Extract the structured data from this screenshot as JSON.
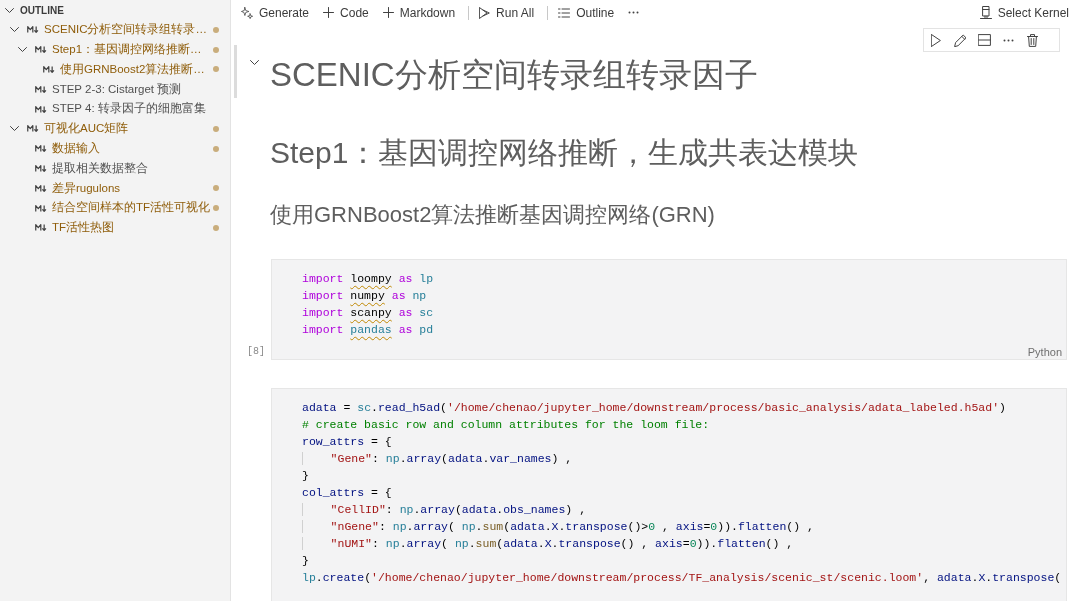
{
  "outline": {
    "title": "OUTLINE",
    "expanded": true,
    "items": [
      {
        "text": "SCENIC分析空间转录组转录…",
        "modified": true,
        "expanded": true,
        "children": [
          {
            "text": "Step1：基因调控网络推断…",
            "modified": true,
            "expanded": true,
            "children": [
              {
                "text": "使用GRNBoost2算法推断…",
                "modified": true
              }
            ]
          },
          {
            "text": "STEP 2-3: Cistarget 预测",
            "modified": false
          },
          {
            "text": "STEP 4: 转录因子的细胞富集",
            "modified": false
          }
        ]
      },
      {
        "text": "可视化AUC矩阵",
        "modified": true,
        "expanded": true,
        "children": [
          {
            "text": "数据输入",
            "modified": true
          },
          {
            "text": "提取相关数据整合",
            "modified": false
          },
          {
            "text": "差异rugulons",
            "modified": true
          },
          {
            "text": "结合空间样本的TF活性可视化",
            "modified": true
          },
          {
            "text": "TF活性热图",
            "modified": true
          }
        ]
      }
    ]
  },
  "toolbar": {
    "groups": [
      [
        {
          "label": "Generate",
          "kind": "generate"
        },
        {
          "label": "Code",
          "kind": "add_code"
        },
        {
          "label": "Markdown",
          "kind": "add_markdown"
        }
      ],
      [
        {
          "label": "Run All",
          "kind": "run_all"
        }
      ],
      [
        {
          "label": "Outline",
          "kind": "outline"
        },
        {
          "kind": "more"
        }
      ]
    ],
    "kernel": {
      "label": "Select Kernel"
    }
  },
  "cells": [
    {
      "kind": "markdown",
      "focused": true,
      "blocks": [
        {
          "kind": "h1",
          "text": "SCENIC分析空间转录组转录因子"
        },
        {
          "kind": "h2",
          "text": "Step1：基因调控网络推断，生成共表达模块"
        },
        {
          "kind": "h3",
          "text": "使用GRNBoost2算法推断基因调控网络(GRN)"
        }
      ]
    },
    {
      "kind": "code",
      "execution_count": "[8]",
      "language": "Python",
      "lines": [
        [
          {
            "text": "import ",
            "kind": "keyword",
            "warning": false
          },
          {
            "text": "loompy",
            "kind": "plain",
            "warning": true
          },
          {
            "text": " as ",
            "kind": "keyword",
            "warning": false
          },
          {
            "text": "lp",
            "kind": "module",
            "warning": false
          }
        ],
        [
          {
            "text": "import ",
            "kind": "keyword",
            "warning": false
          },
          {
            "text": "numpy",
            "kind": "plain",
            "warning": true
          },
          {
            "text": " as ",
            "kind": "keyword",
            "warning": false
          },
          {
            "text": "np",
            "kind": "module",
            "warning": false
          }
        ],
        [
          {
            "text": "import ",
            "kind": "keyword",
            "warning": false
          },
          {
            "text": "scanpy",
            "kind": "plain",
            "warning": true
          },
          {
            "text": " as ",
            "kind": "keyword",
            "warning": false
          },
          {
            "text": "sc",
            "kind": "module",
            "warning": false
          }
        ],
        [
          {
            "text": "import ",
            "kind": "keyword",
            "warning": false
          },
          {
            "text": "pandas",
            "kind": "module",
            "warning": true
          },
          {
            "text": " as ",
            "kind": "keyword",
            "warning": false
          },
          {
            "text": "pd",
            "kind": "module",
            "warning": false
          }
        ]
      ]
    },
    {
      "kind": "code",
      "lines": [
        [
          {
            "text": "adata",
            "kind": "variable"
          },
          {
            "text": " = ",
            "kind": "plain"
          },
          {
            "text": "sc",
            "kind": "module"
          },
          {
            "text": ".",
            "kind": "plain"
          },
          {
            "text": "read_h5ad",
            "kind": "variable"
          },
          {
            "text": "(",
            "kind": "plain"
          },
          {
            "text": "'/home/chenao/jupyter_home/downstream/process/basic_analysis/adata_labeled.h5ad'",
            "kind": "string"
          },
          {
            "text": ")",
            "kind": "plain"
          }
        ],
        [
          {
            "text": "# create basic row and column attributes for the loom file:",
            "kind": "comment"
          }
        ],
        [
          {
            "text": "row_attrs",
            "kind": "variable"
          },
          {
            "text": " = {",
            "kind": "plain"
          }
        ],
        [
          {
            "text": "    \"Gene\"",
            "kind": "string"
          },
          {
            "text": ": ",
            "kind": "plain"
          },
          {
            "text": "np",
            "kind": "module"
          },
          {
            "text": ".",
            "kind": "plain"
          },
          {
            "text": "array",
            "kind": "variable"
          },
          {
            "text": "(",
            "kind": "plain"
          },
          {
            "text": "adata",
            "kind": "variable"
          },
          {
            "text": ".",
            "kind": "plain"
          },
          {
            "text": "var_names",
            "kind": "variable"
          },
          {
            "text": ") ,",
            "kind": "plain"
          }
        ],
        [
          {
            "text": "}",
            "kind": "plain"
          }
        ],
        [
          {
            "text": "col_attrs",
            "kind": "variable"
          },
          {
            "text": " = {",
            "kind": "plain"
          }
        ],
        [
          {
            "text": "    \"CellID\"",
            "kind": "string"
          },
          {
            "text": ": ",
            "kind": "plain"
          },
          {
            "text": "np",
            "kind": "module"
          },
          {
            "text": ".",
            "kind": "plain"
          },
          {
            "text": "array",
            "kind": "variable"
          },
          {
            "text": "(",
            "kind": "plain"
          },
          {
            "text": "adata",
            "kind": "variable"
          },
          {
            "text": ".",
            "kind": "plain"
          },
          {
            "text": "obs_names",
            "kind": "variable"
          },
          {
            "text": ") ,",
            "kind": "plain"
          }
        ],
        [
          {
            "text": "    \"nGene\"",
            "kind": "string"
          },
          {
            "text": ": ",
            "kind": "plain"
          },
          {
            "text": "np",
            "kind": "module"
          },
          {
            "text": ".",
            "kind": "plain"
          },
          {
            "text": "array",
            "kind": "variable"
          },
          {
            "text": "( ",
            "kind": "plain"
          },
          {
            "text": "np",
            "kind": "module"
          },
          {
            "text": ".",
            "kind": "plain"
          },
          {
            "text": "sum",
            "kind": "function"
          },
          {
            "text": "(",
            "kind": "plain"
          },
          {
            "text": "adata",
            "kind": "variable"
          },
          {
            "text": ".",
            "kind": "plain"
          },
          {
            "text": "X",
            "kind": "variable"
          },
          {
            "text": ".",
            "kind": "plain"
          },
          {
            "text": "transpose",
            "kind": "variable"
          },
          {
            "text": "()>",
            "kind": "plain"
          },
          {
            "text": "0",
            "kind": "number"
          },
          {
            "text": " , ",
            "kind": "plain"
          },
          {
            "text": "axis",
            "kind": "variable"
          },
          {
            "text": "=",
            "kind": "plain"
          },
          {
            "text": "0",
            "kind": "number"
          },
          {
            "text": ")).",
            "kind": "plain"
          },
          {
            "text": "flatten",
            "kind": "variable"
          },
          {
            "text": "() ,",
            "kind": "plain"
          }
        ],
        [
          {
            "text": "    \"nUMI\"",
            "kind": "string"
          },
          {
            "text": ": ",
            "kind": "plain"
          },
          {
            "text": "np",
            "kind": "module"
          },
          {
            "text": ".",
            "kind": "plain"
          },
          {
            "text": "array",
            "kind": "variable"
          },
          {
            "text": "( ",
            "kind": "plain"
          },
          {
            "text": "np",
            "kind": "module"
          },
          {
            "text": ".",
            "kind": "plain"
          },
          {
            "text": "sum",
            "kind": "function"
          },
          {
            "text": "(",
            "kind": "plain"
          },
          {
            "text": "adata",
            "kind": "variable"
          },
          {
            "text": ".",
            "kind": "plain"
          },
          {
            "text": "X",
            "kind": "variable"
          },
          {
            "text": ".",
            "kind": "plain"
          },
          {
            "text": "transpose",
            "kind": "variable"
          },
          {
            "text": "() , ",
            "kind": "plain"
          },
          {
            "text": "axis",
            "kind": "variable"
          },
          {
            "text": "=",
            "kind": "plain"
          },
          {
            "text": "0",
            "kind": "number"
          },
          {
            "text": ")).",
            "kind": "plain"
          },
          {
            "text": "flatten",
            "kind": "variable"
          },
          {
            "text": "() ,",
            "kind": "plain"
          }
        ],
        [
          {
            "text": "}",
            "kind": "plain"
          }
        ],
        [
          {
            "text": "lp",
            "kind": "module"
          },
          {
            "text": ".",
            "kind": "plain"
          },
          {
            "text": "create",
            "kind": "variable"
          },
          {
            "text": "(",
            "kind": "plain"
          },
          {
            "text": "'/home/chenao/jupyter_home/downstream/process/TF_analysis/scenic_st/scenic.loom'",
            "kind": "string"
          },
          {
            "text": ", ",
            "kind": "plain"
          },
          {
            "text": "adata",
            "kind": "variable"
          },
          {
            "text": ".",
            "kind": "plain"
          },
          {
            "text": "X",
            "kind": "variable"
          },
          {
            "text": ".",
            "kind": "plain"
          },
          {
            "text": "transpose",
            "kind": "variable"
          },
          {
            "text": "(",
            "kind": "plain"
          }
        ]
      ]
    }
  ]
}
